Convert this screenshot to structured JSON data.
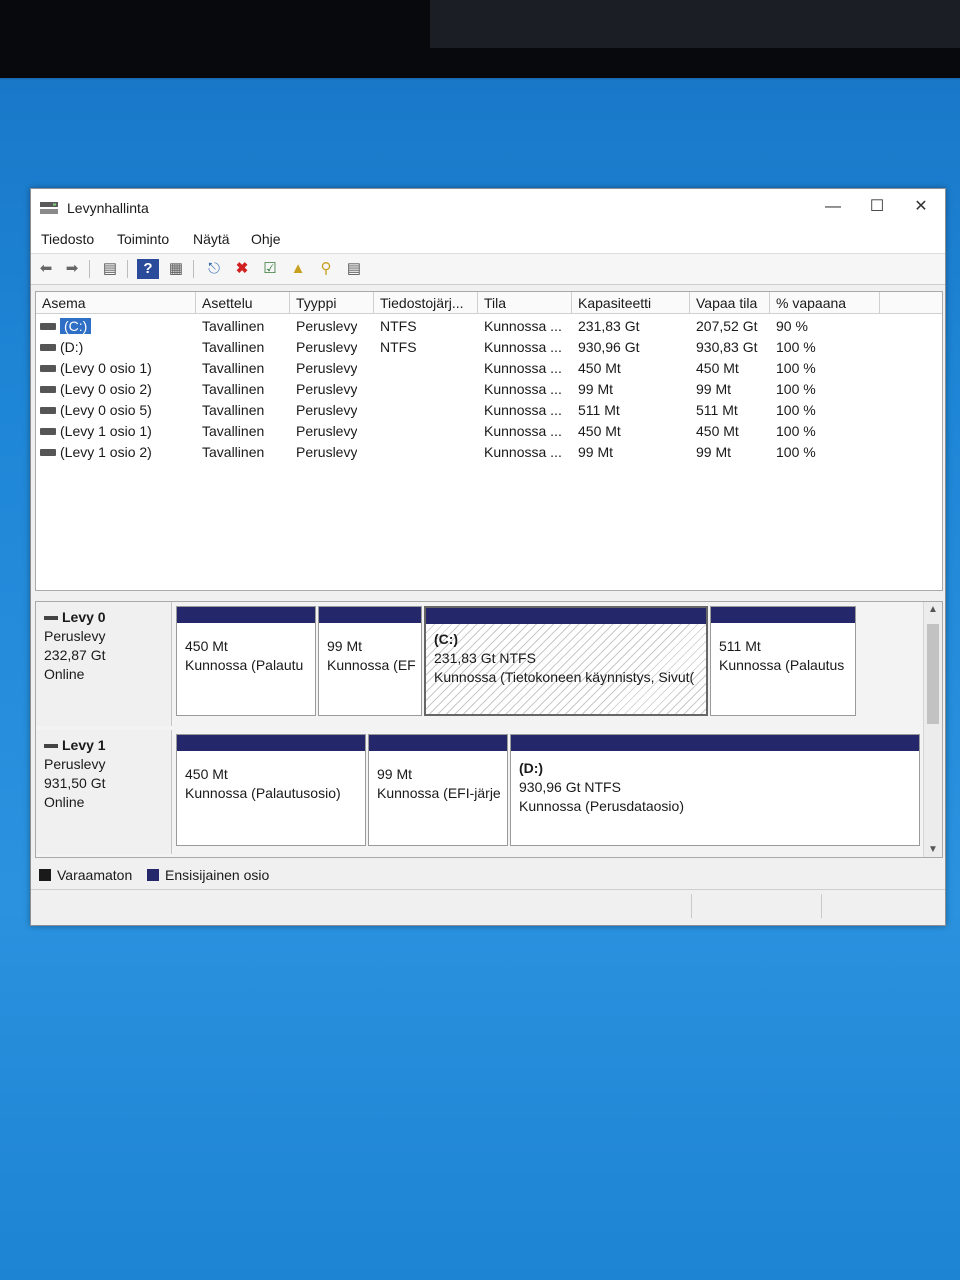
{
  "window": {
    "title": "Levynhallinta"
  },
  "menu": [
    "Tiedosto",
    "Toiminto",
    "Näytä",
    "Ohje"
  ],
  "toolbar_icons": [
    "back-arrow-icon",
    "forward-arrow-icon",
    "properties-list-icon",
    "help-icon",
    "view-icon",
    "connect-icon",
    "delete-icon",
    "check-icon",
    "folder-up-icon",
    "search-folder-icon",
    "options-icon"
  ],
  "columns": [
    "Asema",
    "Asettelu",
    "Tyyppi",
    "Tiedostojärj...",
    "Tila",
    "Kapasiteetti",
    "Vapaa tila",
    "% vapaana"
  ],
  "volumes": [
    {
      "asema": "(C:)",
      "asettelu": "Tavallinen",
      "tyyppi": "Peruslevy",
      "tiedostojarjestelma": "NTFS",
      "tila": "Kunnossa ...",
      "kapasiteetti": "231,83 Gt",
      "vapaa": "207,52 Gt",
      "prosentti": "90 %"
    },
    {
      "asema": "(D:)",
      "asettelu": "Tavallinen",
      "tyyppi": "Peruslevy",
      "tiedostojarjestelma": "NTFS",
      "tila": "Kunnossa ...",
      "kapasiteetti": "930,96 Gt",
      "vapaa": "930,83 Gt",
      "prosentti": "100 %"
    },
    {
      "asema": "(Levy 0 osio 1)",
      "asettelu": "Tavallinen",
      "tyyppi": "Peruslevy",
      "tiedostojarjestelma": "",
      "tila": "Kunnossa ...",
      "kapasiteetti": "450 Mt",
      "vapaa": "450 Mt",
      "prosentti": "100 %"
    },
    {
      "asema": "(Levy 0 osio 2)",
      "asettelu": "Tavallinen",
      "tyyppi": "Peruslevy",
      "tiedostojarjestelma": "",
      "tila": "Kunnossa ...",
      "kapasiteetti": "99 Mt",
      "vapaa": "99 Mt",
      "prosentti": "100 %"
    },
    {
      "asema": "(Levy 0 osio 5)",
      "asettelu": "Tavallinen",
      "tyyppi": "Peruslevy",
      "tiedostojarjestelma": "",
      "tila": "Kunnossa ...",
      "kapasiteetti": "511 Mt",
      "vapaa": "511 Mt",
      "prosentti": "100 %"
    },
    {
      "asema": "(Levy 1 osio 1)",
      "asettelu": "Tavallinen",
      "tyyppi": "Peruslevy",
      "tiedostojarjestelma": "",
      "tila": "Kunnossa ...",
      "kapasiteetti": "450 Mt",
      "vapaa": "450 Mt",
      "prosentti": "100 %"
    },
    {
      "asema": "(Levy 1 osio 2)",
      "asettelu": "Tavallinen",
      "tyyppi": "Peruslevy",
      "tiedostojarjestelma": "",
      "tila": "Kunnossa ...",
      "kapasiteetti": "99 Mt",
      "vapaa": "99 Mt",
      "prosentti": "100 %"
    }
  ],
  "disks": [
    {
      "name": "Levy 0",
      "type": "Peruslevy",
      "size": "232,87 Gt",
      "status": "Online",
      "partitions": [
        {
          "label": "",
          "size": "450 Mt",
          "status": "Kunnossa (Palautu"
        },
        {
          "label": "",
          "size": "99 Mt",
          "status": "Kunnossa (EF"
        },
        {
          "label": "(C:)",
          "size": "231,83 Gt NTFS",
          "status": "Kunnossa (Tietokoneen käynnistys, Sivut("
        },
        {
          "label": "",
          "size": "511 Mt",
          "status": "Kunnossa (Palautus"
        }
      ]
    },
    {
      "name": "Levy 1",
      "type": "Peruslevy",
      "size": "931,50 Gt",
      "status": "Online",
      "partitions": [
        {
          "label": "",
          "size": "450 Mt",
          "status": "Kunnossa (Palautusosio)"
        },
        {
          "label": "",
          "size": "99 Mt",
          "status": "Kunnossa (EFI-järje"
        },
        {
          "label": "(D:)",
          "size": "930,96 Gt NTFS",
          "status": "Kunnossa (Perusdataosio)"
        }
      ]
    }
  ],
  "legend": [
    {
      "label": "Varaamaton",
      "color": "#1a1a1a"
    },
    {
      "label": "Ensisijainen osio",
      "color": "#24286b"
    }
  ]
}
